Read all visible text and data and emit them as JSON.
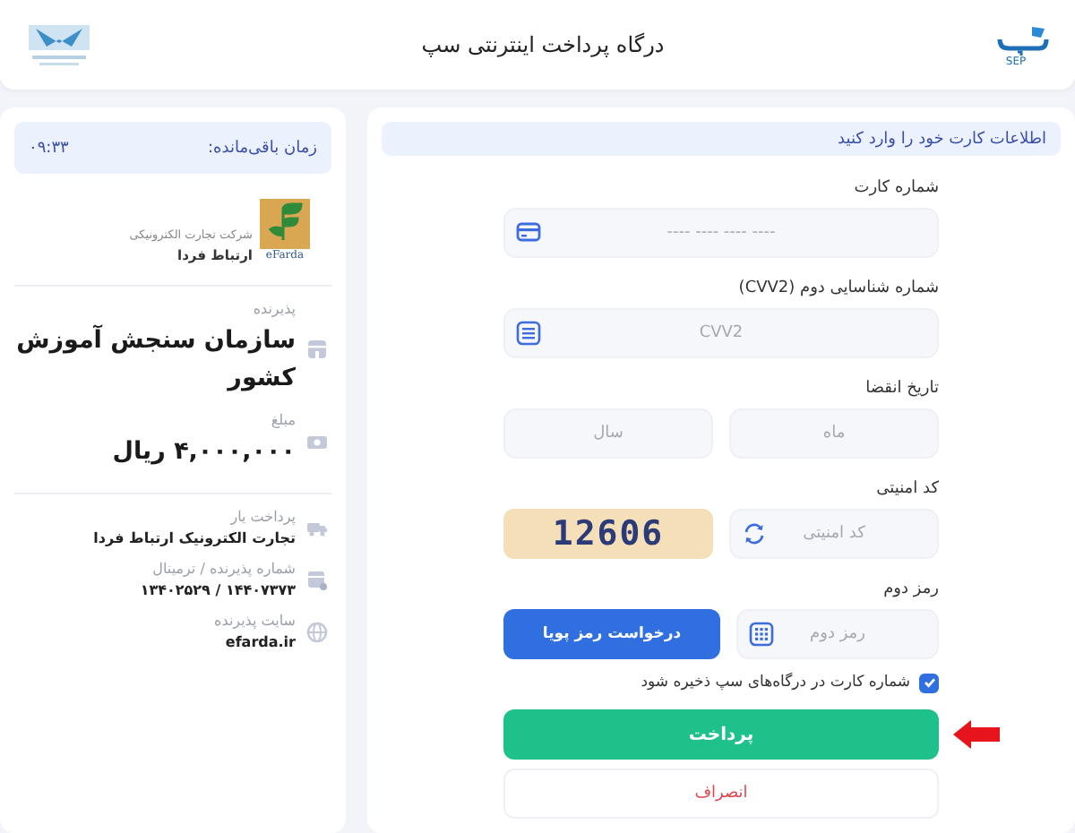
{
  "header": {
    "title": "درگاه پرداخت اینترنتی سپ",
    "logo_text": "SEP"
  },
  "form": {
    "notice": "اطلاعات کارت خود را وارد کنید",
    "card_number": {
      "label": "شماره کارت",
      "placeholder": "---- ---- ---- ----"
    },
    "cvv2": {
      "label": "شماره شناسایی دوم (CVV2)",
      "placeholder": "CVV2"
    },
    "expiry": {
      "label": "تاریخ انقضا",
      "month_placeholder": "ماه",
      "year_placeholder": "سال"
    },
    "captcha": {
      "label": "کد امنیتی",
      "placeholder": "کد امنیتی",
      "code": "12606"
    },
    "second_password": {
      "label": "رمز دوم",
      "placeholder": "رمز دوم",
      "request_button": "درخواست رمز پویا"
    },
    "save_card": {
      "label": "شماره کارت در درگاه‌های سپ ذخیره شود",
      "checked": true
    },
    "pay_button": "پرداخت",
    "cancel_button": "انصراف"
  },
  "merchant": {
    "timer_label": "زمان باقی‌مانده:",
    "timer": "۰۹:۳۳",
    "logo": {
      "line1": "شرکت تجارت الکترونیکی",
      "line2": "ارتباط فردا",
      "brand": "eFarda"
    },
    "summary": [
      {
        "kind": "acceptor",
        "label": "پذیرنده",
        "value": "سازمان سنجش آموزش کشور"
      },
      {
        "kind": "amount",
        "label": "مبلغ",
        "value": "۴,۰۰۰,۰۰۰ ریال"
      }
    ],
    "info": [
      {
        "kind": "provider",
        "label": "پرداخت یار",
        "value": "تجارت الکترونیک ارتباط فردا"
      },
      {
        "kind": "terminal",
        "label": "شماره پذیرنده / ترمینال",
        "value": "۱۴۴۰۷۳۷۳ / ۱۳۴۰۲۵۲۹"
      },
      {
        "kind": "site",
        "label": "سایت پذیرنده",
        "value": "efarda.ir"
      }
    ]
  }
}
